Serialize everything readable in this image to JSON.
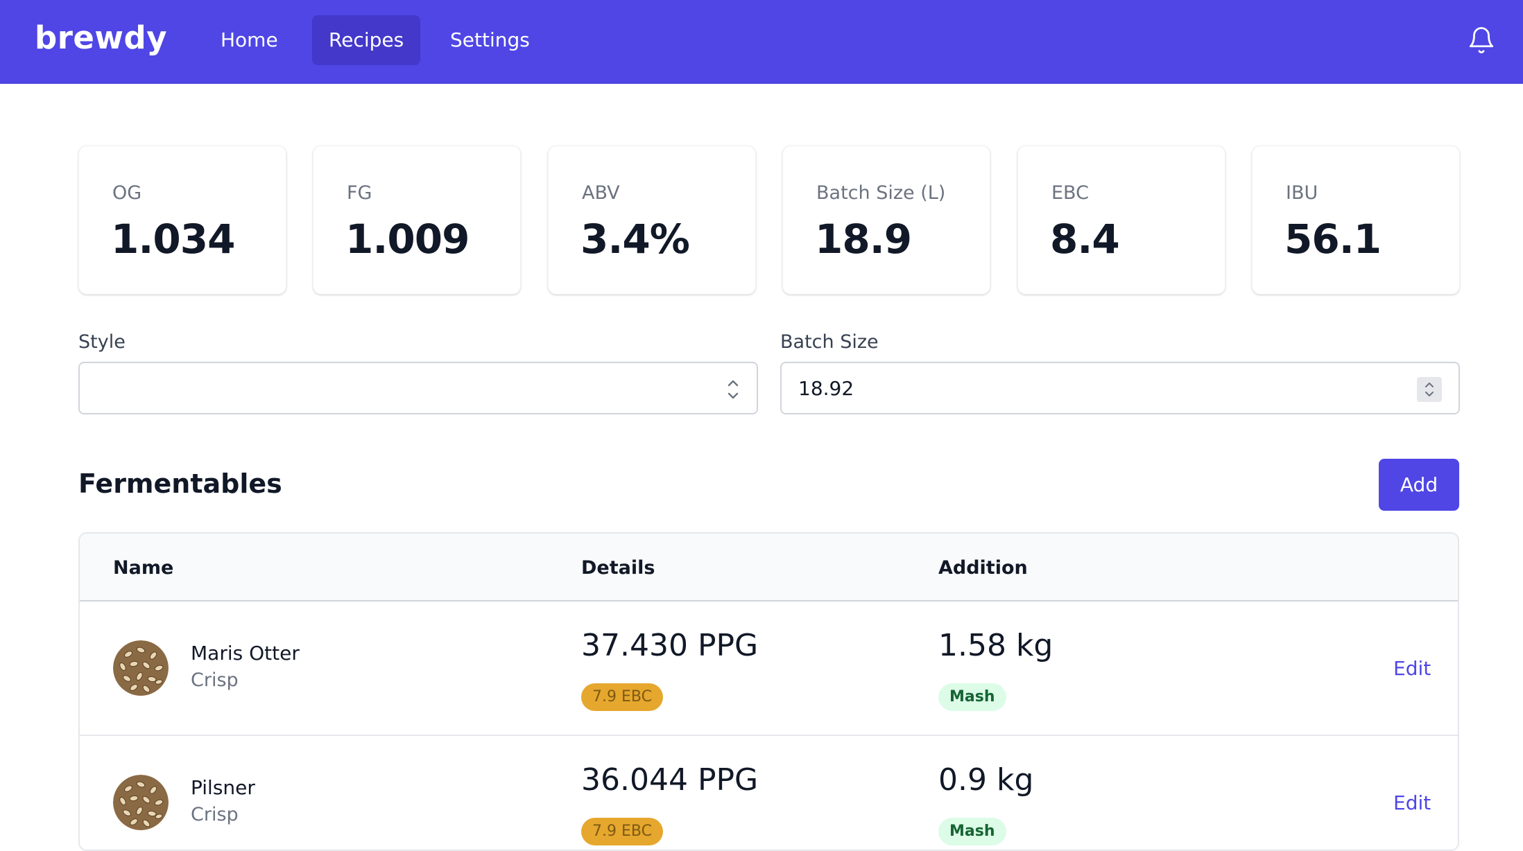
{
  "nav": {
    "brand": "brewdy",
    "items": [
      {
        "label": "Home",
        "active": false
      },
      {
        "label": "Recipes",
        "active": true
      },
      {
        "label": "Settings",
        "active": false
      }
    ],
    "notification_icon": "bell-icon",
    "background_color": "#4f46e5",
    "active_color": "#4338ca"
  },
  "stats": [
    {
      "label": "OG",
      "value": "1.034"
    },
    {
      "label": "FG",
      "value": "1.009"
    },
    {
      "label": "ABV",
      "value": "3.4%"
    },
    {
      "label": "Batch Size (L)",
      "value": "18.9"
    },
    {
      "label": "EBC",
      "value": "8.4"
    },
    {
      "label": "IBU",
      "value": "56.1"
    }
  ],
  "form": {
    "style_label": "Style",
    "style_value": "",
    "batch_size_label": "Batch Size",
    "batch_size_value": "18.92"
  },
  "fermentables": {
    "title": "Fermentables",
    "add_label": "Add",
    "columns": [
      "Name",
      "Details",
      "Addition"
    ],
    "rows": [
      {
        "name": "Maris Otter",
        "subtitle": "Crisp",
        "ppg": "37.430 PPG",
        "ebc": "7.9 EBC",
        "amount": "1.58 kg",
        "stage": "Mash",
        "edit_label": "Edit",
        "image_icon": "grain-image"
      },
      {
        "name": "Pilsner",
        "subtitle": "Crisp",
        "ppg": "36.044 PPG",
        "ebc": "7.9 EBC",
        "amount": "0.9 kg",
        "stage": "Mash",
        "edit_label": "Edit",
        "image_icon": "grain-image"
      }
    ]
  },
  "colors": {
    "accent": "#4f46e5",
    "ebc_badge": "#e6a72e",
    "stage_badge_bg": "#dcfce7",
    "stage_badge_text": "#166534"
  }
}
